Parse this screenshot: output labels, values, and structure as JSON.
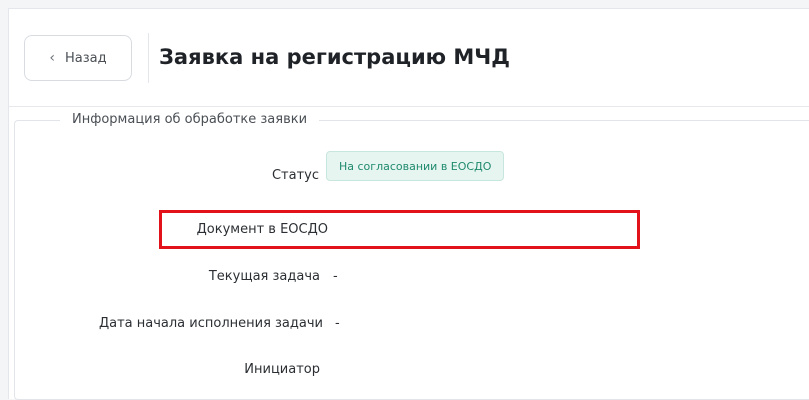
{
  "header": {
    "back_label": "Назад",
    "title": "Заявка на регистрацию МЧД"
  },
  "section": {
    "legend": "Информация об обработке заявки"
  },
  "fields": {
    "status_label": "Статус",
    "status_value": "На согласовании в ЕОСДО",
    "document_label": "Документ в ЕОСДО",
    "task_label": "Текущая задача",
    "task_value": "-",
    "start_date_label": "Дата начала исполнения задачи",
    "start_date_value": "-",
    "initiator_label": "Инициатор"
  },
  "colors": {
    "status_badge_bg": "#e7f5f0",
    "status_badge_text": "#1f8a6d",
    "highlight_border": "#e2111a"
  }
}
